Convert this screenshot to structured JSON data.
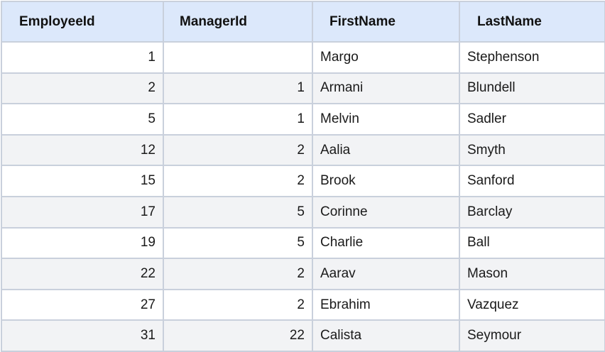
{
  "table": {
    "columns": [
      "EmployeeId",
      "ManagerId",
      "FirstName",
      "LastName"
    ],
    "rows": [
      {
        "employee_id": "1",
        "manager_id": "",
        "first_name": "Margo",
        "last_name": "Stephenson"
      },
      {
        "employee_id": "2",
        "manager_id": "1",
        "first_name": "Armani",
        "last_name": "Blundell"
      },
      {
        "employee_id": "5",
        "manager_id": "1",
        "first_name": "Melvin",
        "last_name": "Sadler"
      },
      {
        "employee_id": "12",
        "manager_id": "2",
        "first_name": "Aalia",
        "last_name": "Smyth"
      },
      {
        "employee_id": "15",
        "manager_id": "2",
        "first_name": "Brook",
        "last_name": "Sanford"
      },
      {
        "employee_id": "17",
        "manager_id": "5",
        "first_name": "Corinne",
        "last_name": "Barclay"
      },
      {
        "employee_id": "19",
        "manager_id": "5",
        "first_name": "Charlie",
        "last_name": "Ball"
      },
      {
        "employee_id": "22",
        "manager_id": "2",
        "first_name": "Aarav",
        "last_name": "Mason"
      },
      {
        "employee_id": "27",
        "manager_id": "2",
        "first_name": "Ebrahim",
        "last_name": "Vazquez"
      },
      {
        "employee_id": "31",
        "manager_id": "22",
        "first_name": "Calista",
        "last_name": "Seymour"
      }
    ]
  },
  "colors": {
    "header_background": "#dce8fb",
    "row_alt_background": "#f2f3f5",
    "grid_line": "#c9d0dc"
  }
}
